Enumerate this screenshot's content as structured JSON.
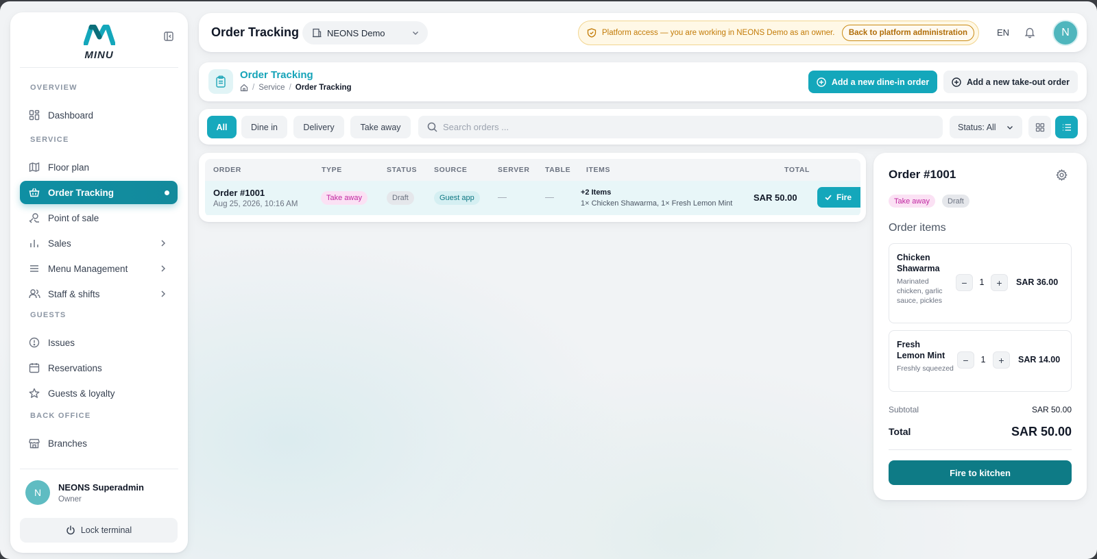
{
  "colors": {
    "accent": "#14a7bb",
    "active_nav": "#0f8fa3",
    "fire_kitchen": "#0e7b86",
    "banner_bg": "#fff8e6",
    "banner_text": "#c27a06",
    "type_pill": "#c026a0"
  },
  "sidebar": {
    "logo_text": "MINU",
    "sections": {
      "overview": "OVERVIEW",
      "service": "SERVICE",
      "guests": "GUESTS",
      "back_office": "BACK OFFICE"
    },
    "items": [
      {
        "label": "Dashboard",
        "icon": "dashboard-icon"
      },
      {
        "label": "Floor plan",
        "icon": "map-icon"
      },
      {
        "label": "Order Tracking",
        "icon": "basket-icon",
        "active": true
      },
      {
        "label": "Point of sale",
        "icon": "pos-icon"
      },
      {
        "label": "Sales",
        "icon": "chart-icon"
      },
      {
        "label": "Menu Management",
        "icon": "menu-icon"
      },
      {
        "label": "Staff & shifts",
        "icon": "users-icon"
      },
      {
        "label": "Issues",
        "icon": "alert-circle-icon"
      },
      {
        "label": "Reservations",
        "icon": "calendar-icon"
      },
      {
        "label": "Guests & loyalty",
        "icon": "star-icon"
      },
      {
        "label": "Branches",
        "icon": "store-icon"
      }
    ],
    "user": {
      "initial": "N",
      "name": "NEONS Superadmin",
      "role": "Owner"
    },
    "lock_label": "Lock terminal"
  },
  "topbar": {
    "title": "Order Tracking",
    "branch": "NEONS Demo",
    "banner_text": "Platform access — you are working in NEONS Demo as an owner.",
    "banner_button": "Back to platform administration",
    "language": "EN",
    "avatar_initial": "N"
  },
  "page": {
    "title": "Order Tracking",
    "breadcrumb": [
      "Service",
      "Order Tracking"
    ],
    "add_dine_in": "Add a new dine-in order",
    "add_take_out": "Add a new take-out order"
  },
  "filters": {
    "chips": [
      "All",
      "Dine in",
      "Delivery",
      "Take away"
    ],
    "search_placeholder": "Search orders ...",
    "status": "Status: All"
  },
  "table": {
    "columns": [
      "ORDER",
      "TYPE",
      "STATUS",
      "SOURCE",
      "SERVER",
      "TABLE",
      "ITEMS",
      "TOTAL"
    ],
    "rows": [
      {
        "order": "Order #1001",
        "date": "Aug 25, 2026, 10:16 AM",
        "type": "Take away",
        "status": "Draft",
        "source": "Guest app",
        "server": "—",
        "table": "—",
        "items_count": "+2 Items",
        "items": "1× Chicken Shawarma, 1× Fresh Lemon Mint",
        "total": "SAR 50.00",
        "action": "Fire"
      }
    ]
  },
  "detail": {
    "title": "Order #1001",
    "type": "Take away",
    "status": "Draft",
    "items_heading": "Order items",
    "items": [
      {
        "name": "Chicken Shawarma",
        "description": "Marinated chicken, garlic sauce, pickles",
        "qty": "1",
        "price": "SAR 36.00"
      },
      {
        "name": "Fresh Lemon Mint",
        "description": "Freshly squeezed",
        "qty": "1",
        "price": "SAR 14.00"
      }
    ],
    "subtotal_label": "Subtotal",
    "subtotal": "SAR 50.00",
    "total_label": "Total",
    "total": "SAR 50.00",
    "fire_label": "Fire to kitchen"
  }
}
